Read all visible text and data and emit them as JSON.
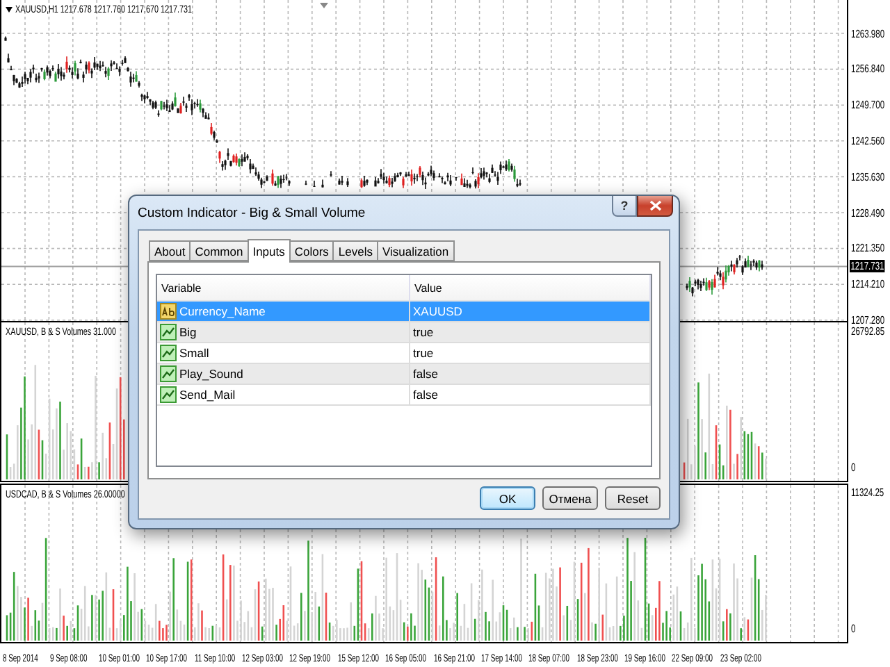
{
  "chart": {
    "title": "XAUUSD,H1 1217.678 1217.760 1217.670 1217.731",
    "price_axis": [
      {
        "label": "1263.980",
        "kind": "tick"
      },
      {
        "label": "1256.840",
        "kind": "tick"
      },
      {
        "label": "1249.700",
        "kind": "tick"
      },
      {
        "label": "1242.560",
        "kind": "tick"
      },
      {
        "label": "1235.630",
        "kind": "tick"
      },
      {
        "label": "1228.490",
        "kind": "tick"
      },
      {
        "label": "1221.350",
        "kind": "tick"
      },
      {
        "label": "1217.731",
        "kind": "current"
      },
      {
        "label": "1214.210",
        "kind": "tick"
      },
      {
        "label": "1207.280",
        "kind": "tick"
      }
    ]
  },
  "volume_panes": [
    {
      "title": "XAUUSD, B & S Volumes 31.000",
      "axis": [
        "26792.85",
        "0"
      ]
    },
    {
      "title": "USDCAD, B & S Volumes 26.00000",
      "axis": [
        "11324.25",
        "0"
      ]
    }
  ],
  "time_axis": [
    "8 Sep 2014",
    "9 Sep 08:00",
    "10 Sep 01:00",
    "10 Sep 17:00",
    "11 Sep 10:00",
    "12 Sep 03:00",
    "12 Sep 19:00",
    "15 Sep 12:00",
    "16 Sep 05:00",
    "16 Sep 21:00",
    "17 Sep 14:00",
    "18 Sep 07:00",
    "18 Sep 23:00",
    "19 Sep 16:00",
    "22 Sep 09:00",
    "23 Sep 02:00"
  ],
  "dialog": {
    "title": "Custom Indicator - Big & Small Volume",
    "help_label": "?",
    "tabs": [
      {
        "label": "About",
        "selected": false
      },
      {
        "label": "Common",
        "selected": false
      },
      {
        "label": "Inputs",
        "selected": true
      },
      {
        "label": "Colors",
        "selected": false
      },
      {
        "label": "Levels",
        "selected": false
      },
      {
        "label": "Visualization",
        "selected": false
      }
    ],
    "columns": [
      "Variable",
      "Value"
    ],
    "rows": [
      {
        "kind": "string",
        "variable": "Currency_Name",
        "value": "XAUUSD",
        "selected": true
      },
      {
        "kind": "bool",
        "variable": "Big",
        "value": "true",
        "selected": false
      },
      {
        "kind": "bool",
        "variable": "Small",
        "value": "true",
        "selected": false
      },
      {
        "kind": "bool",
        "variable": "Play_Sound",
        "value": "false",
        "selected": false
      },
      {
        "kind": "bool",
        "variable": "Send_Mail",
        "value": "false",
        "selected": false
      }
    ],
    "buttons": [
      {
        "label": "OK",
        "default": true
      },
      {
        "label": "Отмена",
        "default": false
      },
      {
        "label": "Reset",
        "default": false
      }
    ]
  }
}
